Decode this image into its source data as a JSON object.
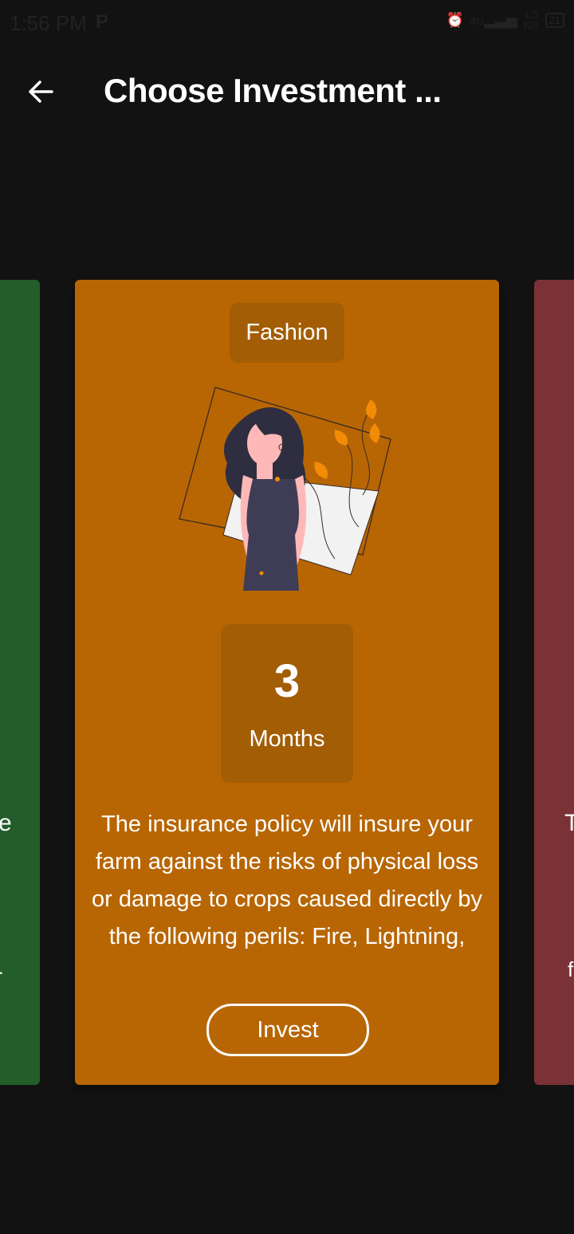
{
  "status_bar": {
    "time": "1:56 PM",
    "carrier_icon": "P",
    "network": "4G",
    "speed_value": "1.5",
    "speed_unit": "K/s",
    "battery": "21"
  },
  "app_bar": {
    "title": "Choose Investment ...",
    "back_icon": "arrow-left-icon"
  },
  "carousel": {
    "left_card": {
      "color": "#225d2a",
      "fragments": [
        "e",
        "."
      ]
    },
    "current_card": {
      "color": "#b86603",
      "category": "Fashion",
      "duration_value": "3",
      "duration_unit": "Months",
      "description": "The insurance policy will insure your farm against the risks of physical loss or damage to crops caused directly by the following perils: Fire, Lightning,",
      "button_label": "Invest",
      "illustration": "fashion-woman-illustration"
    },
    "right_card": {
      "color": "#7a3236",
      "fragments": [
        "T",
        "f"
      ]
    }
  }
}
